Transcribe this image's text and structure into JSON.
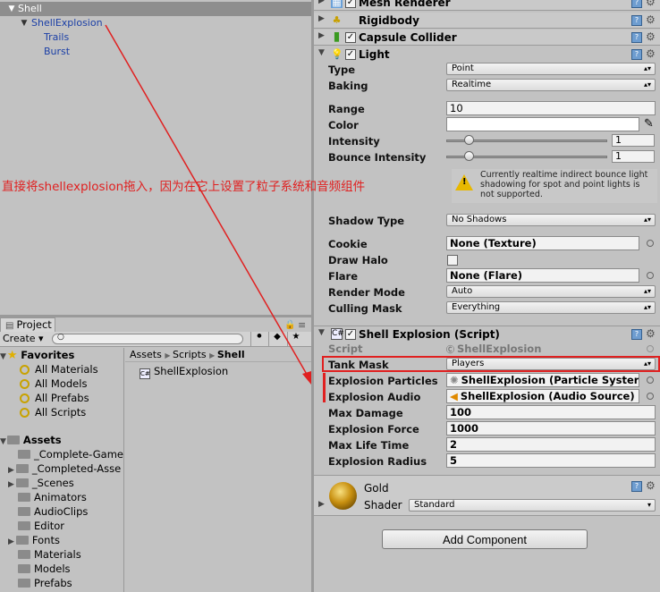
{
  "hierarchy": {
    "items": [
      {
        "label": "Shell"
      },
      {
        "label": "ShellExplosion"
      },
      {
        "label": "Trails"
      },
      {
        "label": "Burst"
      }
    ]
  },
  "annotation": {
    "text": "直接将shellexplosion拖入，因为在它上设置了粒子系统和音频组件",
    "color": "#e02020"
  },
  "inspector": {
    "components": {
      "mesh_renderer": "Mesh Renderer",
      "rigidbody": "Rigidbody",
      "capsule_collider": "Capsule Collider",
      "light": "Light",
      "shell_explosion": "Shell Explosion (Script)"
    },
    "light": {
      "type_label": "Type",
      "type_value": "Point",
      "baking_label": "Baking",
      "baking_value": "Realtime",
      "range_label": "Range",
      "range_value": "10",
      "color_label": "Color",
      "intensity_label": "Intensity",
      "intensity_value": "1",
      "bounce_label": "Bounce Intensity",
      "bounce_value": "1",
      "warning": "Currently realtime indirect bounce light shadowing for spot and point lights is not supported.",
      "shadow_type_label": "Shadow Type",
      "shadow_type_value": "No Shadows",
      "cookie_label": "Cookie",
      "cookie_value": "None (Texture)",
      "draw_halo_label": "Draw Halo",
      "flare_label": "Flare",
      "flare_value": "None (Flare)",
      "render_mode_label": "Render Mode",
      "render_mode_value": "Auto",
      "culling_mask_label": "Culling Mask",
      "culling_mask_value": "Everything"
    },
    "shell_explosion": {
      "script_label": "Script",
      "script_value": "ShellExplosion",
      "tank_mask_label": "Tank Mask",
      "tank_mask_value": "Players",
      "explosion_particles_label": "Explosion Particles",
      "explosion_particles_value": "ShellExplosion (Particle Syster",
      "explosion_audio_label": "Explosion Audio",
      "explosion_audio_value": "ShellExplosion (Audio Source)",
      "max_damage_label": "Max Damage",
      "max_damage_value": "100",
      "explosion_force_label": "Explosion Force",
      "explosion_force_value": "1000",
      "max_life_time_label": "Max Life Time",
      "max_life_time_value": "2",
      "explosion_radius_label": "Explosion Radius",
      "explosion_radius_value": "5"
    },
    "material": {
      "name": "Gold",
      "shader_label": "Shader",
      "shader_value": "Standard"
    },
    "add_component_label": "Add Component"
  },
  "project": {
    "tab_label": "Project",
    "create_label": "Create",
    "favorites_label": "Favorites",
    "favorites": [
      "All Materials",
      "All Models",
      "All Prefabs",
      "All Scripts"
    ],
    "assets_label": "Assets",
    "folders": [
      "_Complete-Game",
      "_Completed-Asse",
      "_Scenes",
      "Animators",
      "AudioClips",
      "Editor",
      "Fonts",
      "Materials",
      "Models",
      "Prefabs"
    ],
    "breadcrumb": [
      "Assets",
      "Scripts",
      "Shell"
    ],
    "files": [
      "ShellExplosion"
    ]
  }
}
